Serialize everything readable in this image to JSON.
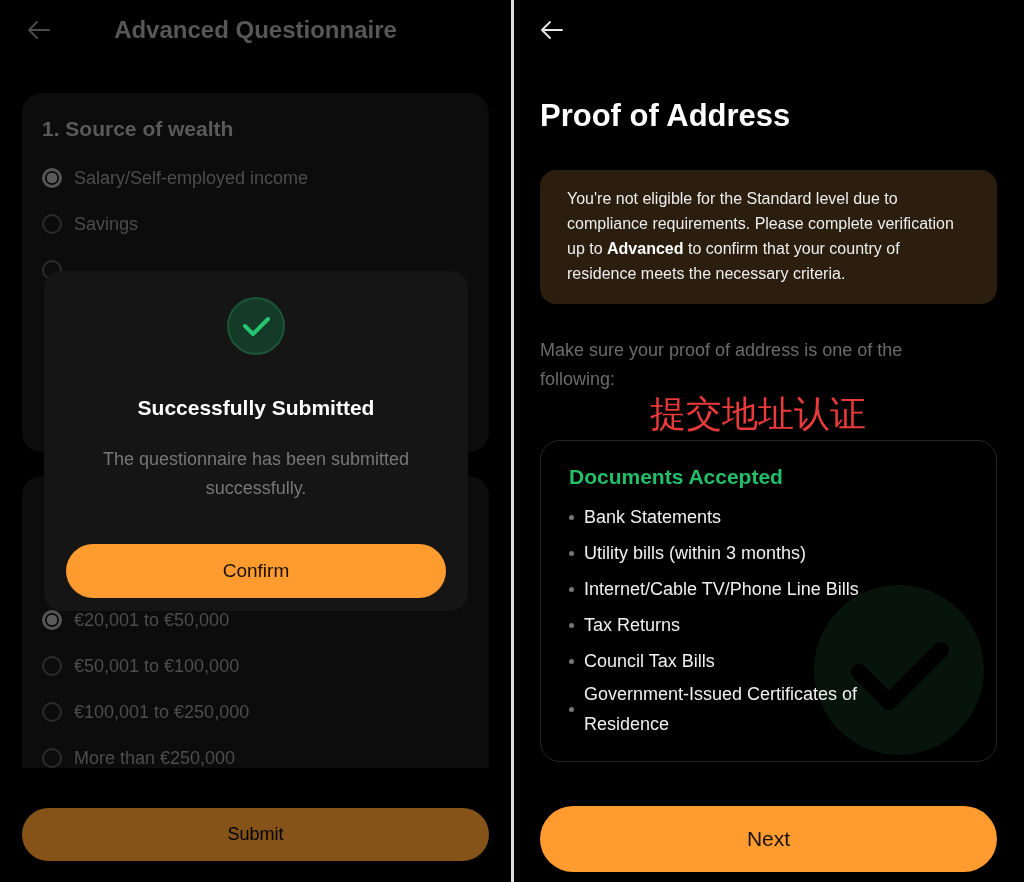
{
  "left_screen": {
    "title": "Advanced Questionnaire",
    "questions": [
      {
        "title": "1. Source of wealth",
        "options": [
          {
            "label": "Salary/Self-employed income",
            "selected": true
          },
          {
            "label": "Savings",
            "selected": false
          },
          {
            "selected": false
          }
        ]
      },
      {
        "options": [
          {
            "label": "€20,001 to €50,000",
            "selected": true
          },
          {
            "label": "€50,001 to €100,000",
            "selected": false
          },
          {
            "label": "€100,001 to €250,000",
            "selected": false
          },
          {
            "label": "More than €250,000",
            "selected": false
          }
        ]
      }
    ],
    "submit_button": "Submit",
    "dialog": {
      "title": "Successfully Submitted",
      "message": "The questionnaire has been submitted successfully.",
      "confirm_button": "Confirm"
    }
  },
  "right_screen": {
    "title": "Proof of Address",
    "notice": "You're not eligible for the Standard level due to compliance requirements. Please complete verification up to **Advanced** to confirm that your country of residence meets the necessary criteria.",
    "instructions": "Make sure your proof of address is one of the following:",
    "annotation": "提交地址认证",
    "documents_card": {
      "title": "Documents Accepted",
      "items": [
        "Bank Statements",
        "Utility bills (within 3 months)",
        "Internet/Cable TV/Phone Line Bills",
        "Tax Returns",
        "Council Tax Bills",
        "Government-Issued Certificates of Residence"
      ]
    },
    "next_button": "Next"
  }
}
